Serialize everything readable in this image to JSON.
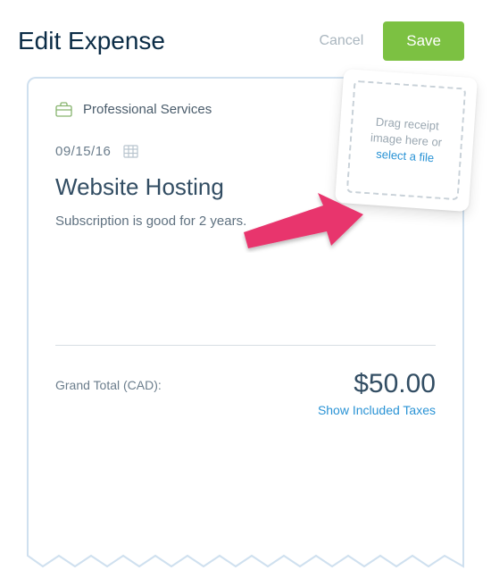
{
  "header": {
    "title": "Edit Expense",
    "cancel_label": "Cancel",
    "save_label": "Save"
  },
  "expense": {
    "category": "Professional Services",
    "date": "09/15/16",
    "title": "Website Hosting",
    "description": "Subscription is good for 2 years."
  },
  "receipt_drop": {
    "line1": "Drag receipt",
    "line2": "image here or",
    "link": "select a file"
  },
  "totals": {
    "label": "Grand Total (CAD):",
    "amount": "$50.00",
    "taxes_link": "Show Included Taxes"
  }
}
